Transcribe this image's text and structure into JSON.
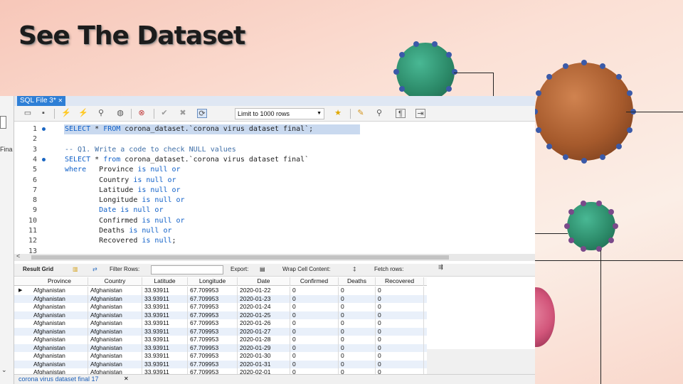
{
  "slide": {
    "title": "See The Dataset"
  },
  "colors": {
    "virus_green": "#2f9b7a",
    "virus_orange": "#a65a2c",
    "virus_spike": "#3b5aa8",
    "virus_pink": "#d2557a"
  },
  "workbench": {
    "tab_label": "SQL File 3*",
    "left_panel_text": "Fina",
    "toolbar": {
      "limit_label": "Limit to 1000 rows",
      "icons": [
        "folder-open-icon",
        "save-icon",
        "execute-icon",
        "execute-current-icon",
        "explain-icon",
        "stop-icon",
        "toggle-stop-icon",
        "commit-icon",
        "rollback-icon",
        "autocommit-icon",
        "beautify-icon",
        "find-icon",
        "invisible-chars-icon",
        "wrap-icon"
      ]
    },
    "editor": {
      "lines": [
        {
          "n": "1",
          "dot": true,
          "selected": true,
          "segments": [
            [
              "kw",
              "SELECT"
            ],
            [
              "t",
              " * "
            ],
            [
              "kw",
              "FROM"
            ],
            [
              "t",
              " corona_dataset.`corona virus dataset final`;"
            ]
          ]
        },
        {
          "n": "2",
          "dot": false,
          "selected": false,
          "segments": []
        },
        {
          "n": "3",
          "dot": false,
          "selected": false,
          "segments": [
            [
              "cm",
              "-- Q1. Write a code to check NULL values"
            ]
          ]
        },
        {
          "n": "4",
          "dot": true,
          "selected": false,
          "segments": [
            [
              "kw",
              "SELECT"
            ],
            [
              "t",
              " * "
            ],
            [
              "kw",
              "from"
            ],
            [
              "t",
              " corona_dataset.`corona virus dataset final`"
            ]
          ]
        },
        {
          "n": "5",
          "dot": false,
          "selected": false,
          "segments": [
            [
              "kw",
              "where"
            ],
            [
              "t",
              "   Province "
            ],
            [
              "kw",
              "is null or"
            ]
          ]
        },
        {
          "n": "6",
          "dot": false,
          "selected": false,
          "segments": [
            [
              "t",
              "        Country "
            ],
            [
              "kw",
              "is null or"
            ]
          ]
        },
        {
          "n": "7",
          "dot": false,
          "selected": false,
          "segments": [
            [
              "t",
              "        Latitude "
            ],
            [
              "kw",
              "is null or"
            ]
          ]
        },
        {
          "n": "8",
          "dot": false,
          "selected": false,
          "segments": [
            [
              "t",
              "        Longitude "
            ],
            [
              "kw",
              "is null or"
            ]
          ]
        },
        {
          "n": "9",
          "dot": false,
          "selected": false,
          "segments": [
            [
              "kw",
              "        Date is null or"
            ]
          ]
        },
        {
          "n": "10",
          "dot": false,
          "selected": false,
          "segments": [
            [
              "t",
              "        Confirmed "
            ],
            [
              "kw",
              "is null or"
            ]
          ]
        },
        {
          "n": "11",
          "dot": false,
          "selected": false,
          "segments": [
            [
              "t",
              "        Deaths "
            ],
            [
              "kw",
              "is null or"
            ]
          ]
        },
        {
          "n": "12",
          "dot": false,
          "selected": false,
          "segments": [
            [
              "t",
              "        Recovered "
            ],
            [
              "kw",
              "is null"
            ],
            [
              "t",
              ";"
            ]
          ]
        },
        {
          "n": "13",
          "dot": false,
          "selected": false,
          "segments": []
        }
      ]
    },
    "result_toolbar": {
      "result_grid": "Result Grid",
      "filter_rows": "Filter Rows:",
      "export": "Export:",
      "wrap": "Wrap Cell Content:",
      "fetch": "Fetch rows:"
    },
    "grid": {
      "columns": [
        "Province",
        "Country",
        "Latitude",
        "Longitude",
        "Date",
        "Confirmed",
        "Deaths",
        "Recovered"
      ],
      "rows": [
        [
          "Afghanistan",
          "Afghanistan",
          "33.93911",
          "67.709953",
          "2020-01-22",
          "0",
          "0",
          "0"
        ],
        [
          "Afghanistan",
          "Afghanistan",
          "33.93911",
          "67.709953",
          "2020-01-23",
          "0",
          "0",
          "0"
        ],
        [
          "Afghanistan",
          "Afghanistan",
          "33.93911",
          "67.709953",
          "2020-01-24",
          "0",
          "0",
          "0"
        ],
        [
          "Afghanistan",
          "Afghanistan",
          "33.93911",
          "67.709953",
          "2020-01-25",
          "0",
          "0",
          "0"
        ],
        [
          "Afghanistan",
          "Afghanistan",
          "33.93911",
          "67.709953",
          "2020-01-26",
          "0",
          "0",
          "0"
        ],
        [
          "Afghanistan",
          "Afghanistan",
          "33.93911",
          "67.709953",
          "2020-01-27",
          "0",
          "0",
          "0"
        ],
        [
          "Afghanistan",
          "Afghanistan",
          "33.93911",
          "67.709953",
          "2020-01-28",
          "0",
          "0",
          "0"
        ],
        [
          "Afghanistan",
          "Afghanistan",
          "33.93911",
          "67.709953",
          "2020-01-29",
          "0",
          "0",
          "0"
        ],
        [
          "Afghanistan",
          "Afghanistan",
          "33.93911",
          "67.709953",
          "2020-01-30",
          "0",
          "0",
          "0"
        ],
        [
          "Afghanistan",
          "Afghanistan",
          "33.93911",
          "67.709953",
          "2020-01-31",
          "0",
          "0",
          "0"
        ],
        [
          "Afghanistan",
          "Afghanistan",
          "33.93911",
          "67.709953",
          "2020-02-01",
          "0",
          "0",
          "0"
        ]
      ]
    },
    "status_tab": "corona virus dataset final 17"
  }
}
